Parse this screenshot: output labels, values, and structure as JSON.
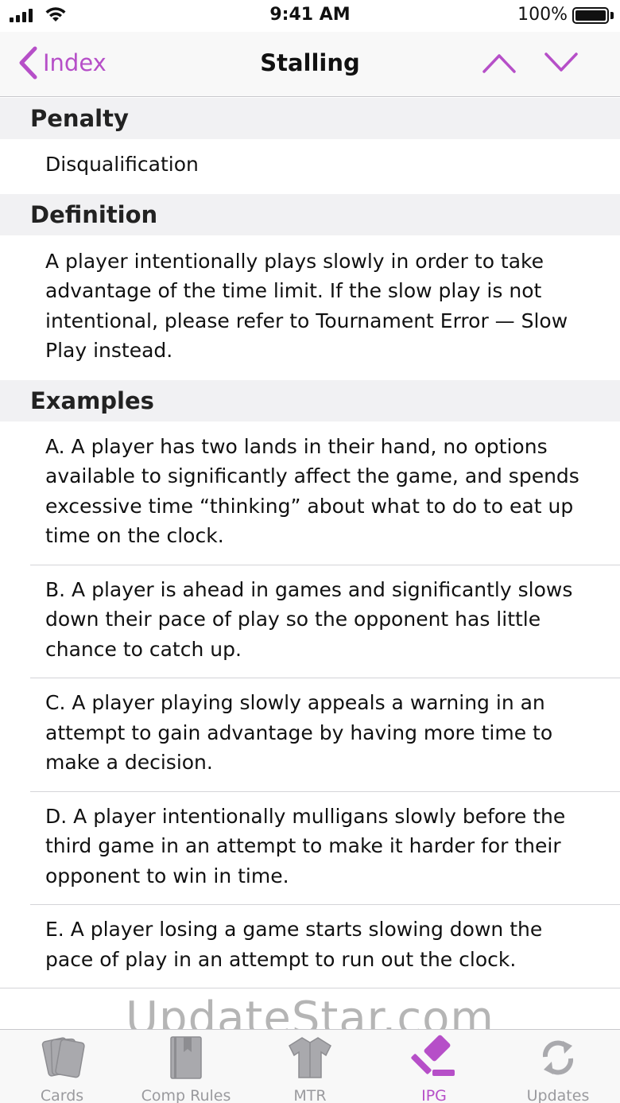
{
  "status_bar": {
    "time": "9:41 AM",
    "battery_percent": "100%"
  },
  "nav": {
    "back_label": "Index",
    "title": "Stalling",
    "accent_color": "#b64fc8"
  },
  "sections": {
    "penalty": {
      "header": "Penalty",
      "body": "Disqualification"
    },
    "definition": {
      "header": "Definition",
      "body": "A player intentionally plays slowly in order to take advantage of the time limit. If the slow play is not intentional, please refer to Tournament Error — Slow Play instead."
    },
    "examples": {
      "header": "Examples",
      "items": [
        "A. A player has two lands in their hand, no options available to significantly affect the game, and spends excessive time “thinking” about what to do to eat up time on the clock.",
        "B. A player is ahead in games and significantly slows down their pace of play so the opponent has little chance to catch up.",
        "C. A player playing slowly appeals a warning in an attempt to gain advantage by having more time to make a decision.",
        "D. A player intentionally mulligans slowly before the third game in an attempt to make it harder for their opponent to win in time.",
        "E. A player losing a game starts slowing down the pace of play in an attempt to run out the clock."
      ]
    }
  },
  "tab_bar": {
    "tabs": [
      {
        "label": "Cards",
        "icon": "cards-icon"
      },
      {
        "label": "Comp Rules",
        "icon": "book-icon"
      },
      {
        "label": "MTR",
        "icon": "shirt-icon"
      },
      {
        "label": "IPG",
        "icon": "gavel-icon",
        "active": true
      },
      {
        "label": "Updates",
        "icon": "refresh-icon"
      }
    ]
  },
  "watermark": "UpdateStar.com"
}
